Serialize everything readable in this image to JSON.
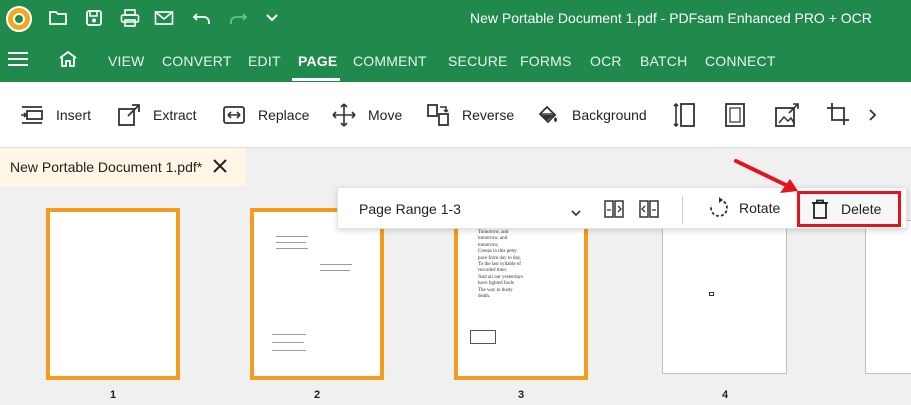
{
  "window": {
    "title": "New Portable Document 1.pdf   -   PDFsam Enhanced PRO + OCR"
  },
  "quick_access": [
    "open-folder-icon",
    "save-icon",
    "print-icon",
    "mail-icon",
    "undo-icon",
    "redo-icon",
    "chevron-down-icon"
  ],
  "menu": {
    "items": [
      {
        "label": "VIEW"
      },
      {
        "label": "CONVERT"
      },
      {
        "label": "EDIT"
      },
      {
        "label": "PAGE",
        "active": true
      },
      {
        "label": "COMMENT"
      },
      {
        "label": "SECURE"
      },
      {
        "label": "FORMS"
      },
      {
        "label": "OCR"
      },
      {
        "label": "BATCH"
      },
      {
        "label": "CONNECT"
      }
    ]
  },
  "toolbar": {
    "insert": "Insert",
    "extract": "Extract",
    "replace": "Replace",
    "move": "Move",
    "reverse": "Reverse",
    "background": "Background"
  },
  "tab": {
    "label": "New Portable Document 1.pdf*"
  },
  "floatbar": {
    "range": "Page Range 1-3",
    "rotate": "Rotate",
    "delete": "Delete"
  },
  "pages": [
    {
      "number": "1",
      "selected": true
    },
    {
      "number": "2",
      "selected": true
    },
    {
      "number": "3",
      "selected": true
    },
    {
      "number": "4",
      "selected": false
    }
  ],
  "page3_text": "Tomorrow, and\ntomorrow, and\ntomorrow,\nCreeps in this petty\npace from day to day,\nTo the last syllable of\nrecorded time;\nAnd all our yesterdays\nhave lighted fools\nThe way to dusty\ndeath.",
  "colors": {
    "brand_green": "#1f8a4c",
    "selection_orange": "#f39c1f",
    "highlight_red": "#e3141c"
  }
}
